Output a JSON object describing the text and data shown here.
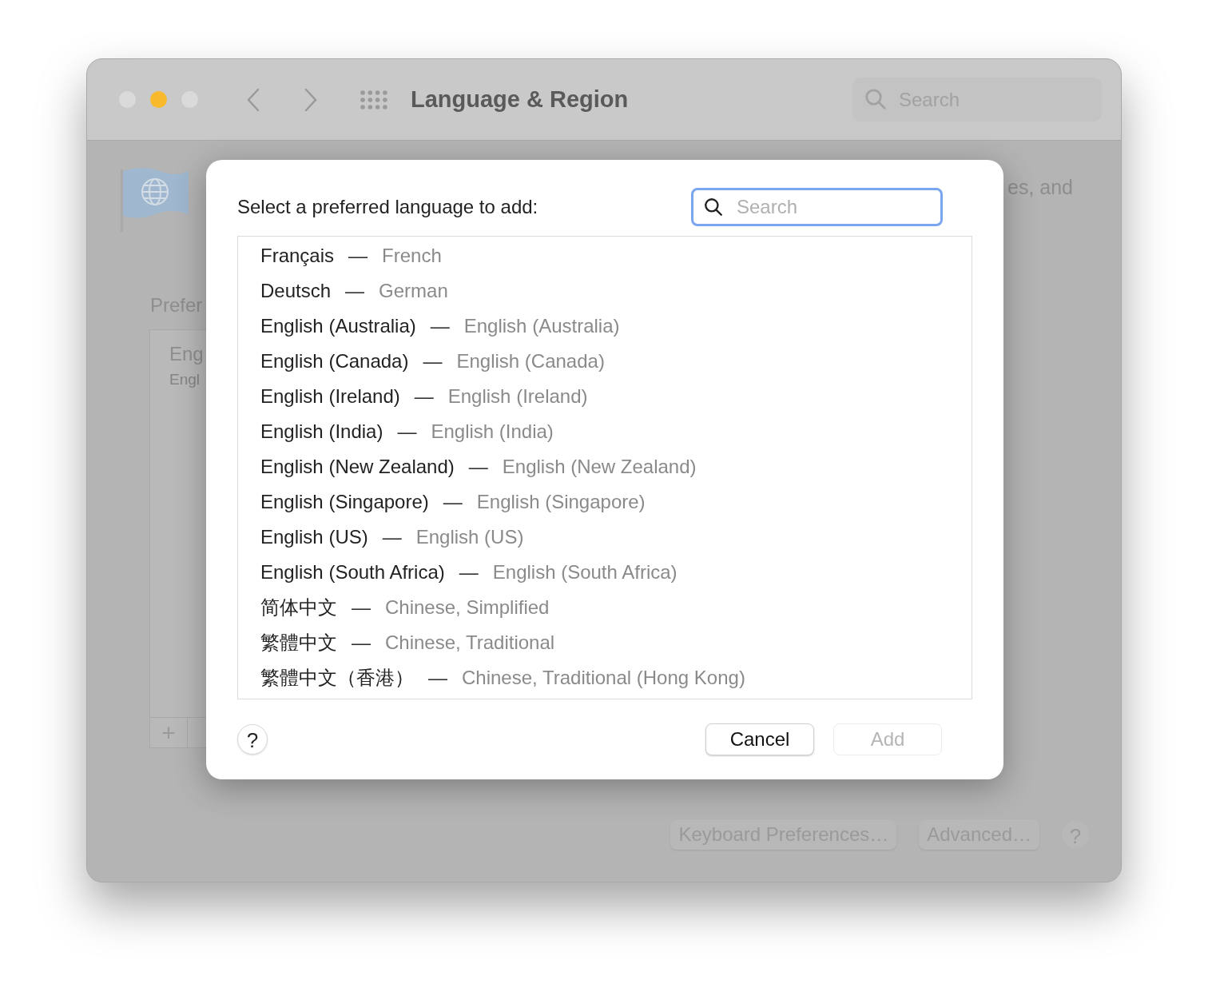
{
  "window": {
    "traffic_lights": [
      {
        "color": "#dadada"
      },
      {
        "color": "#f8b92c"
      },
      {
        "color": "#dadada"
      }
    ],
    "title": "Language & Region",
    "search": {
      "placeholder": "Search"
    }
  },
  "background": {
    "intro_text": "es, and",
    "section_label": "Prefer",
    "languages": [
      {
        "name": "Eng",
        "subtitle": "Engl"
      }
    ],
    "add_button": "+",
    "buttons": [
      {
        "label": "Keyboard Preferences…"
      },
      {
        "label": "Advanced…"
      }
    ],
    "help_button": "?"
  },
  "dialog": {
    "prompt": "Select a preferred language to add:",
    "search": {
      "placeholder": "Search"
    },
    "languages": [
      {
        "native": "Français",
        "separator": "—",
        "english": "French"
      },
      {
        "native": "Deutsch",
        "separator": "—",
        "english": "German"
      },
      {
        "native": "English (Australia)",
        "separator": "—",
        "english": "English (Australia)"
      },
      {
        "native": "English (Canada)",
        "separator": "—",
        "english": "English (Canada)"
      },
      {
        "native": "English (Ireland)",
        "separator": "—",
        "english": "English (Ireland)"
      },
      {
        "native": "English (India)",
        "separator": "—",
        "english": "English (India)"
      },
      {
        "native": "English (New Zealand)",
        "separator": "—",
        "english": "English (New Zealand)"
      },
      {
        "native": "English (Singapore)",
        "separator": "—",
        "english": "English (Singapore)"
      },
      {
        "native": "English (US)",
        "separator": "—",
        "english": "English (US)"
      },
      {
        "native": "English (South Africa)",
        "separator": "—",
        "english": "English (South Africa)"
      },
      {
        "native": "简体中文",
        "separator": "—",
        "english": "Chinese, Simplified"
      },
      {
        "native": "繁體中文",
        "separator": "—",
        "english": "Chinese, Traditional"
      },
      {
        "native": "繁體中文（香港）",
        "separator": "—",
        "english": "Chinese, Traditional (Hong Kong)"
      }
    ],
    "help_button": "?",
    "buttons": [
      {
        "label": "Cancel",
        "disabled": false
      },
      {
        "label": "Add",
        "disabled": true
      }
    ]
  }
}
